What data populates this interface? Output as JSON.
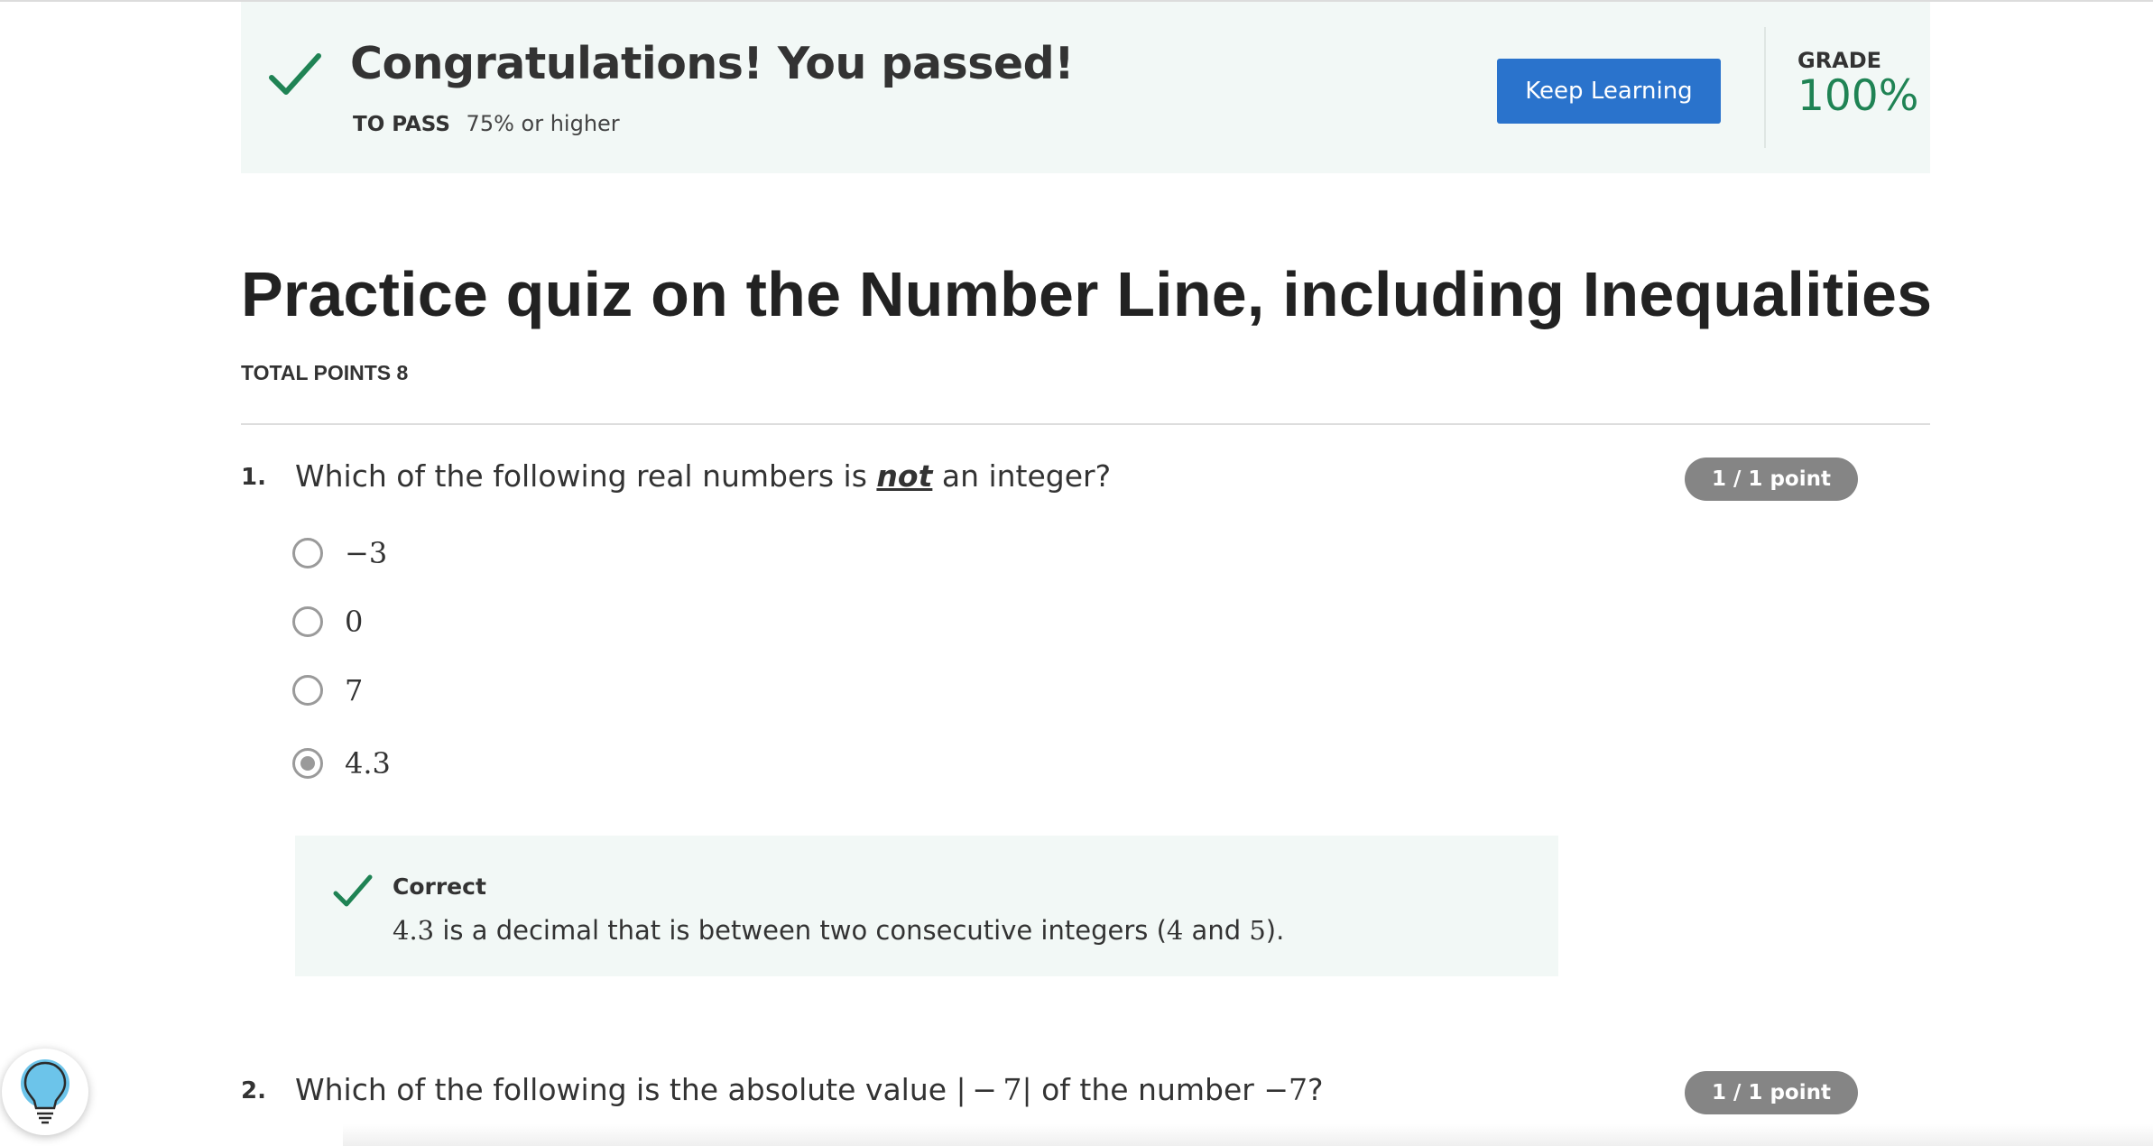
{
  "banner": {
    "title": "Congratulations! You passed!",
    "to_pass_label": "TO PASS",
    "to_pass_value": "75% or higher",
    "keep_learning_label": "Keep Learning",
    "grade_label": "GRADE",
    "grade_value": "100%"
  },
  "quiz": {
    "title": "Practice quiz on the Number Line, including Inequalities",
    "total_points": "TOTAL POINTS 8"
  },
  "questions": [
    {
      "number": "1.",
      "text_before": "Which of the following real numbers is ",
      "text_emphasis": "not",
      "text_after": " an integer?",
      "points": "1 / 1 point",
      "options": [
        {
          "label": "−3",
          "selected": false
        },
        {
          "label": "0",
          "selected": false
        },
        {
          "label": "7",
          "selected": false
        },
        {
          "label": "4.3",
          "selected": true
        }
      ],
      "feedback": {
        "title": "Correct",
        "value": "4.3",
        "text_mid": " is a decimal that is between two consecutive integers (",
        "num_a": "4",
        "and": " and ",
        "num_b": "5",
        "text_end": ")."
      }
    },
    {
      "number": "2.",
      "text_before": "Which of the following is the absolute value ",
      "math_abs": "| − 7|",
      "text_mid": " of the number ",
      "math_num": "−7",
      "text_after": "?",
      "points": "1 / 1 point"
    }
  ],
  "colors": {
    "banner_bg": "#f2f8f6",
    "success_green": "#1f8354",
    "button_blue": "#2a73cc",
    "badge_gray": "#858585"
  },
  "icons": {
    "banner": "checkmark-icon",
    "feedback": "checkmark-icon",
    "help": "lightbulb-icon"
  }
}
